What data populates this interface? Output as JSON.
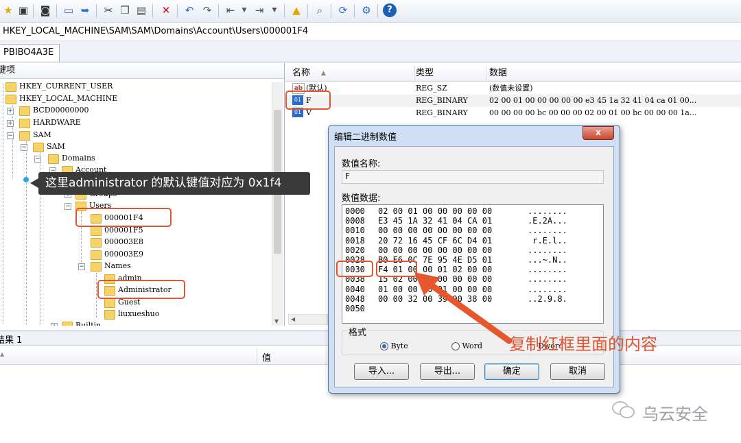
{
  "address": "HKEY_LOCAL_MACHINE\\SAM\\SAM\\Domains\\Account\\Users\\000001F4",
  "tab": "PBIBO4A3E",
  "left_header": "键项",
  "tree": [
    {
      "label": "HKEY_CURRENT_USER"
    },
    {
      "label": "HKEY_LOCAL_MACHINE"
    },
    {
      "label": "BCD00000000"
    },
    {
      "label": "HARDWARE"
    },
    {
      "label": "SAM"
    },
    {
      "label": "SAM"
    },
    {
      "label": "Domains"
    },
    {
      "label": "Account"
    },
    {
      "label": "Groups"
    },
    {
      "label": "Users"
    },
    {
      "label": "000001F4"
    },
    {
      "label": "000001F5"
    },
    {
      "label": "000003E8"
    },
    {
      "label": "000003E9"
    },
    {
      "label": "Names"
    },
    {
      "label": "admin"
    },
    {
      "label": "Administrator"
    },
    {
      "label": "Guest"
    },
    {
      "label": "liuxueshuo"
    },
    {
      "label": "Builtin"
    }
  ],
  "columns": {
    "name": "名称",
    "type": "类型",
    "data": "数据"
  },
  "values": [
    {
      "icon": "ab",
      "name": "(默认)",
      "type": "REG_SZ",
      "data": "(数值未设置)"
    },
    {
      "icon": "binary",
      "name": "F",
      "type": "REG_BINARY",
      "data": "02 00 01 00 00 00 00 00 e3 45 1a 32 41 04 ca 01 00..."
    },
    {
      "icon": "binary",
      "name": "V",
      "type": "REG_BINARY",
      "data": "00 00 00 00 bc 00 00 00 02 00 01 00 bc 00 00 00 1a..."
    }
  ],
  "results_label": "结果 1",
  "bottom_col": "值",
  "callout": "这里administrator 的默认键值对应为 0x1f4",
  "dialog": {
    "title": "编辑二进制数值",
    "close": "x",
    "name_label": "数值名称:",
    "name_value": "F",
    "data_label": "数值数据:",
    "hex_rows": [
      {
        "off": "0000",
        "hex": "02 00 01 00 00 00 00 00",
        "ascii": "........"
      },
      {
        "off": "0008",
        "hex": "E3 45 1A 32 41 04 CA 01",
        "ascii": ".E.2A..."
      },
      {
        "off": "0010",
        "hex": "00 00 00 00 00 00 00 00",
        "ascii": "........"
      },
      {
        "off": "0018",
        "hex": "20 72 16 45 CF 6C D4 01",
        "ascii": " r.E.l.."
      },
      {
        "off": "0020",
        "hex": "00 00 00 00 00 00 00 00",
        "ascii": "........"
      },
      {
        "off": "0028",
        "hex": "B0 E6 0C 7E 95 4E D5 01",
        "ascii": "...~.N.."
      },
      {
        "off": "0030",
        "hex": "F4 01 00 00 01 02 00 00",
        "ascii": "........"
      },
      {
        "off": "0038",
        "hex": "15 02 00 00 00 00 00 00",
        "ascii": "........"
      },
      {
        "off": "0040",
        "hex": "01 00 00 00 01 00 00 00",
        "ascii": "........"
      },
      {
        "off": "0048",
        "hex": "00 00 32 00 39 00 38 00",
        "ascii": "..2.9.8."
      },
      {
        "off": "0050",
        "hex": "",
        "ascii": ""
      }
    ],
    "format_label": "格式",
    "formats": [
      "Byte",
      "Word",
      "Dword"
    ],
    "selected_format": "Byte",
    "buttons": {
      "import": "导入...",
      "export": "导出...",
      "ok": "确定",
      "cancel": "取消"
    }
  },
  "annotation": "复制红框里面的内容",
  "watermark": "乌云安全",
  "accent_color": "#e0542f"
}
